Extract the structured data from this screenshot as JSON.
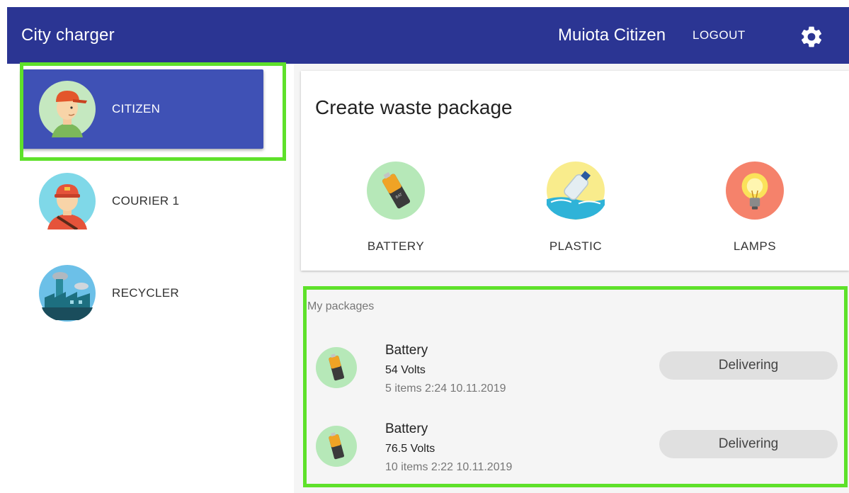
{
  "header": {
    "app_title": "City charger",
    "user_name": "Muiota Citizen",
    "logout_label": "LOGOUT",
    "settings_icon": "gear-icon",
    "bg_color": "#2b3593"
  },
  "sidebar": {
    "roles": [
      {
        "label": "CITIZEN",
        "icon": "citizen-avatar",
        "active": true
      },
      {
        "label": "COURIER  1",
        "icon": "courier-avatar",
        "active": false
      },
      {
        "label": "RECYCLER",
        "icon": "recycler-factory-icon",
        "active": false
      }
    ],
    "active_color": "#3f51b5"
  },
  "create": {
    "title": "Create waste package",
    "types": [
      {
        "label": "BATTERY",
        "icon": "battery-icon"
      },
      {
        "label": "PLASTIC",
        "icon": "plastic-bottle-icon"
      },
      {
        "label": "LAMPS",
        "icon": "light-bulb-icon"
      }
    ]
  },
  "packages": {
    "heading": "My packages",
    "items": [
      {
        "title": "Battery",
        "volts": "54 Volts",
        "meta": "5 items 2:24 10.11.2019",
        "status": "Delivering"
      },
      {
        "title": "Battery",
        "volts": "76.5 Volts",
        "meta": "10 items 2:22 10.11.2019",
        "status": "Delivering"
      }
    ]
  },
  "highlight_color": "#5ee12a"
}
